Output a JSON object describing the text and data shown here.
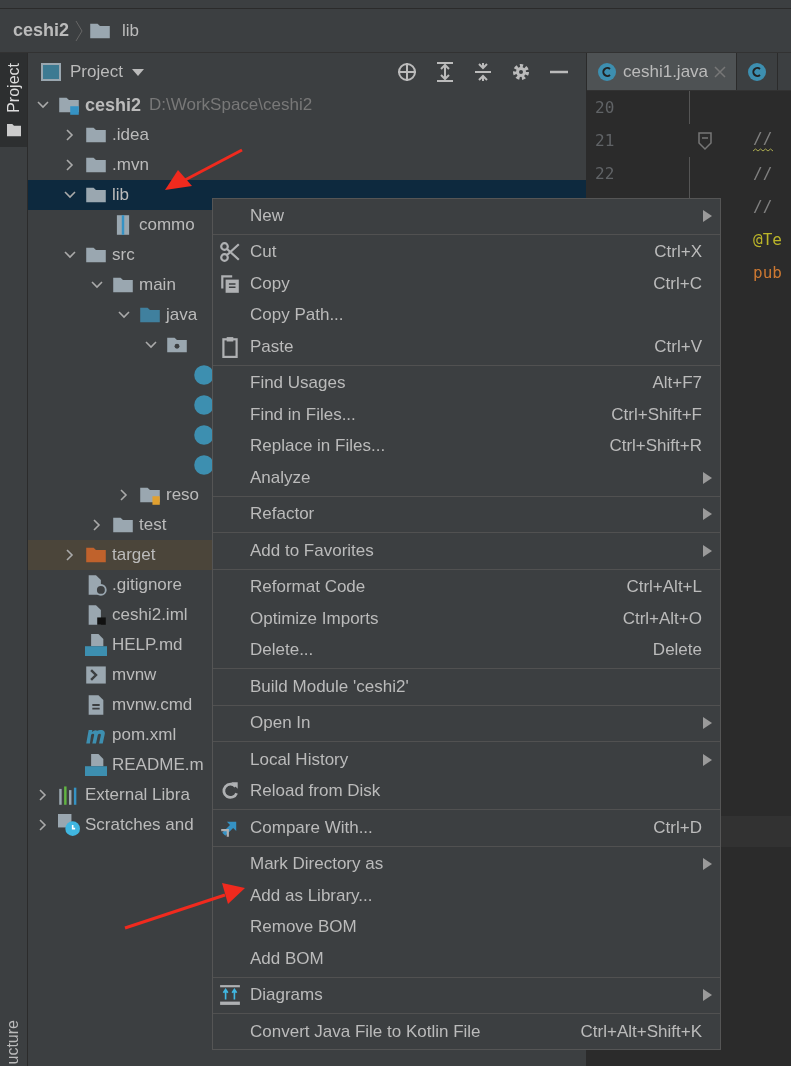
{
  "breadcrumb": {
    "project": "ceshi2",
    "folder": "lib"
  },
  "tool_strip": {
    "tabs": [
      {
        "label": "Project",
        "selected": true
      }
    ],
    "bottom_tab": "ucture"
  },
  "project_panel": {
    "title": "Project",
    "tree": [
      {
        "label": "ceshi2",
        "path": "D:\\WorkSpace\\ceshi2",
        "kind": "project",
        "expanded": true,
        "selected": false,
        "children": [
          {
            "label": ".idea",
            "kind": "folder",
            "expanded": false,
            "selected": false
          },
          {
            "label": ".mvn",
            "kind": "folder",
            "expanded": false,
            "selected": false
          },
          {
            "label": "lib",
            "kind": "folder",
            "expanded": true,
            "selected": true,
            "children": [
              {
                "label": "commo",
                "kind": "archive",
                "selected": false
              }
            ]
          },
          {
            "label": "src",
            "kind": "folder",
            "expanded": true,
            "selected": false,
            "children": [
              {
                "label": "main",
                "kind": "folder",
                "expanded": true,
                "selected": false,
                "children": [
                  {
                    "label": "java",
                    "kind": "source",
                    "expanded": true,
                    "selected": false,
                    "children": [
                      {
                        "kind": "package",
                        "expanded": true,
                        "selected": false,
                        "children": [
                          {
                            "kind": "class",
                            "selected": false
                          },
                          {
                            "kind": "class",
                            "selected": false
                          },
                          {
                            "kind": "class",
                            "selected": false
                          },
                          {
                            "kind": "class",
                            "selected": false
                          }
                        ]
                      }
                    ]
                  },
                  {
                    "label": "reso",
                    "kind": "resources",
                    "expanded": false,
                    "selected": false
                  }
                ]
              },
              {
                "label": "test",
                "kind": "folder",
                "expanded": false,
                "selected": false
              }
            ]
          },
          {
            "label": "target",
            "kind": "excluded",
            "expanded": false,
            "selected": false,
            "excluded": true
          },
          {
            "label": ".gitignore",
            "kind": "ignore",
            "selected": false
          },
          {
            "label": "ceshi2.iml",
            "kind": "module",
            "selected": false
          },
          {
            "label": "HELP.md",
            "kind": "markdown",
            "selected": false
          },
          {
            "label": "mvnw",
            "kind": "script",
            "selected": false
          },
          {
            "label": "mvnw.cmd",
            "kind": "text",
            "selected": false
          },
          {
            "label": "pom.xml",
            "kind": "maven",
            "selected": false
          },
          {
            "label": "README.m",
            "kind": "markdown",
            "selected": false
          }
        ]
      },
      {
        "label": "External Libra",
        "kind": "libraries",
        "expanded": false,
        "selected": false
      },
      {
        "label": "Scratches and",
        "kind": "scratches",
        "expanded": false,
        "selected": false
      }
    ]
  },
  "editor": {
    "tabs": [
      {
        "label": "ceshi1.java",
        "selected": true
      },
      {
        "selected": false
      }
    ],
    "lines": [
      {
        "number": "20",
        "fold": false,
        "warning": false
      },
      {
        "number": "21",
        "code": "//",
        "kind": "comment",
        "fold": true,
        "warning": true
      },
      {
        "number": "22",
        "code": "//",
        "kind": "comment",
        "fold": false,
        "warning": false
      },
      {
        "code": "//",
        "kind": "comment",
        "fold": false,
        "warning": false
      },
      {
        "code": "@Te",
        "kind": "annotation",
        "fold": false,
        "warning": false
      },
      {
        "code": "pub",
        "kind": "keyword",
        "fold": false,
        "warning": false
      }
    ]
  },
  "context_menu": {
    "groups": [
      [
        {
          "label": "New",
          "submenu": true
        }
      ],
      [
        {
          "label": "Cut",
          "shortcut": "Ctrl+X",
          "kind": "cut",
          "submenu": false
        },
        {
          "label": "Copy",
          "shortcut": "Ctrl+C",
          "kind": "copy",
          "submenu": false
        },
        {
          "label": "Copy Path...",
          "submenu": false
        },
        {
          "label": "Paste",
          "shortcut": "Ctrl+V",
          "kind": "paste",
          "submenu": false
        }
      ],
      [
        {
          "label": "Find Usages",
          "shortcut": "Alt+F7",
          "submenu": false
        },
        {
          "label": "Find in Files...",
          "shortcut": "Ctrl+Shift+F",
          "submenu": false
        },
        {
          "label": "Replace in Files...",
          "shortcut": "Ctrl+Shift+R",
          "submenu": false
        },
        {
          "label": "Analyze",
          "submenu": true
        }
      ],
      [
        {
          "label": "Refactor",
          "submenu": true
        }
      ],
      [
        {
          "label": "Add to Favorites",
          "submenu": true
        }
      ],
      [
        {
          "label": "Reformat Code",
          "shortcut": "Ctrl+Alt+L",
          "submenu": false
        },
        {
          "label": "Optimize Imports",
          "shortcut": "Ctrl+Alt+O",
          "submenu": false
        },
        {
          "label": "Delete...",
          "shortcut": "Delete",
          "submenu": false
        }
      ],
      [
        {
          "label": "Build Module 'ceshi2'",
          "submenu": false
        }
      ],
      [
        {
          "label": "Open In",
          "submenu": true
        }
      ],
      [
        {
          "label": "Local History",
          "submenu": true
        },
        {
          "label": "Reload from Disk",
          "kind": "reload",
          "submenu": false
        }
      ],
      [
        {
          "label": "Compare With...",
          "shortcut": "Ctrl+D",
          "kind": "compare",
          "submenu": false
        }
      ],
      [
        {
          "label": "Mark Directory as",
          "submenu": true
        },
        {
          "label": "Add as Library...",
          "submenu": false
        },
        {
          "label": "Remove BOM",
          "submenu": false
        },
        {
          "label": "Add BOM",
          "submenu": false
        }
      ],
      [
        {
          "label": "Diagrams",
          "kind": "diagrams",
          "submenu": true
        }
      ],
      [
        {
          "label": "Convert Java File to Kotlin File",
          "shortcut": "Ctrl+Alt+Shift+K",
          "submenu": false
        }
      ]
    ]
  }
}
